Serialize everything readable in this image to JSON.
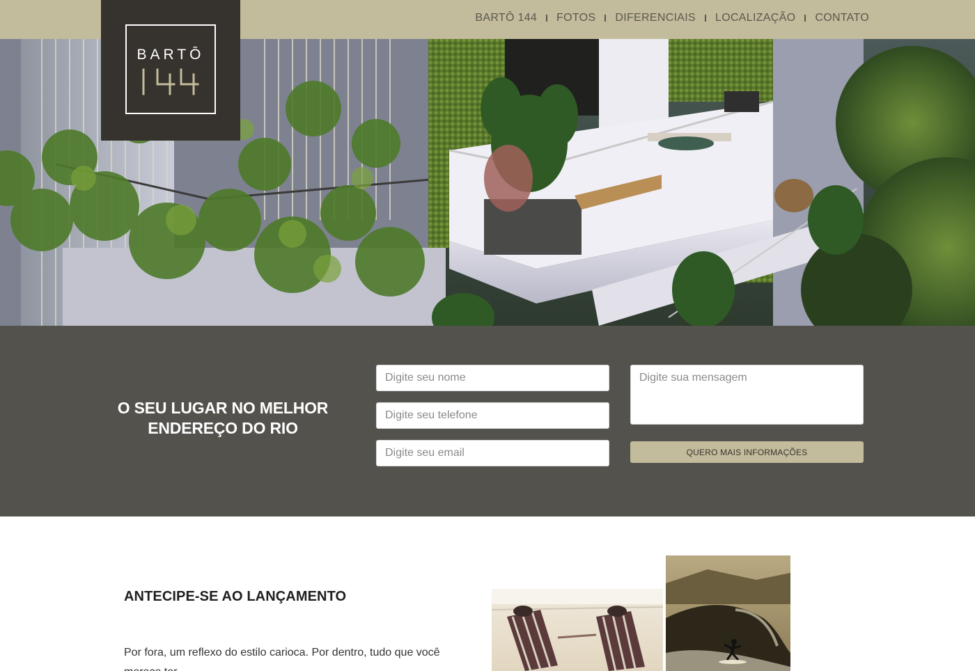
{
  "brand": {
    "name": "BARTŌ",
    "number": "144"
  },
  "nav": {
    "items": [
      {
        "label": "BARTÔ 144"
      },
      {
        "label": "FOTOS"
      },
      {
        "label": "DIFERENCIAIS"
      },
      {
        "label": "LOCALIZAÇÃO"
      },
      {
        "label": "CONTATO"
      }
    ]
  },
  "form": {
    "tagline": "O SEU LUGAR NO MELHOR ENDEREÇO DO RIO",
    "name_placeholder": "Digite seu nome",
    "phone_placeholder": "Digite seu telefone",
    "email_placeholder": "Digite seu email",
    "message_placeholder": "Digite sua mensagem",
    "submit_label": "QUERO MAIS INFORMAÇÕES"
  },
  "content": {
    "title": "ANTECIPE-SE AO LANÇAMENTO",
    "text": "Por fora, um reflexo do estilo carioca. Por dentro, tudo que você merece ter."
  },
  "colors": {
    "accent": "#c3bc9c",
    "logo_bg": "#36322d",
    "band_bg": "#53524d"
  }
}
